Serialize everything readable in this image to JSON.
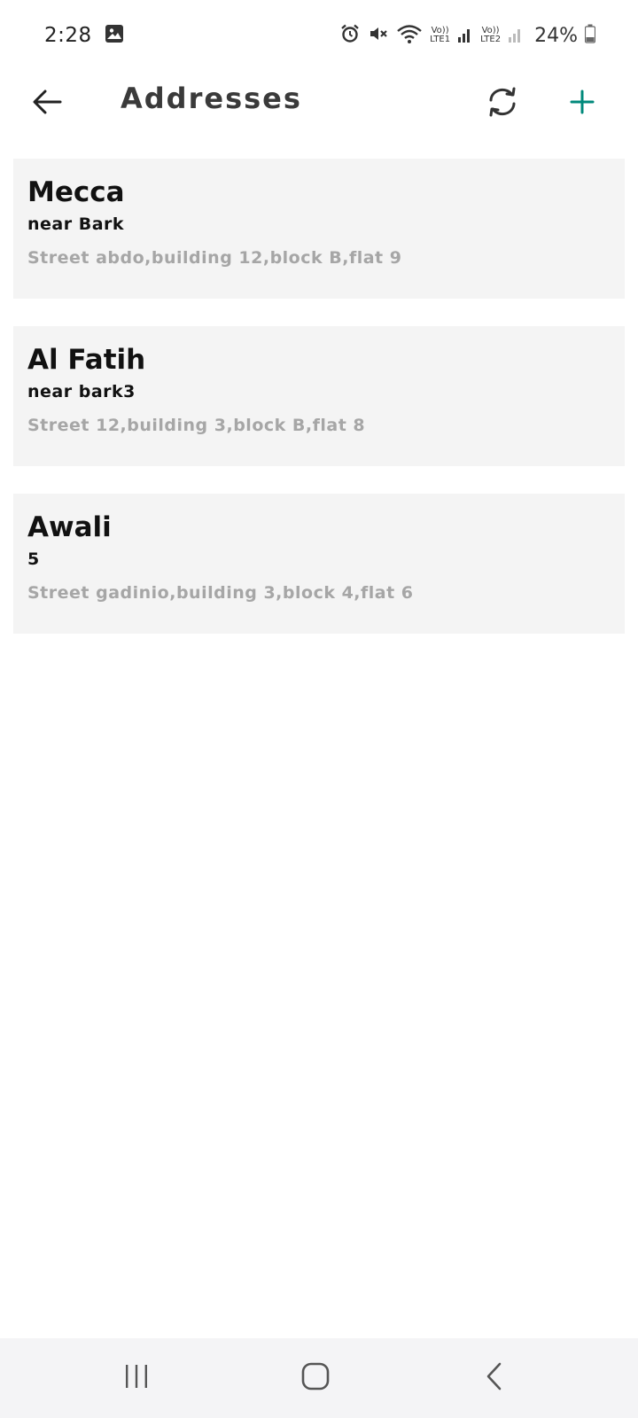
{
  "status_bar": {
    "time": "2:28",
    "net1_top": "Vo))",
    "net1_bottom": "LTE1",
    "net2_top": "Vo))",
    "net2_bottom": "LTE2",
    "battery": "24%"
  },
  "header": {
    "title": "Addresses",
    "accent_color": "#00897b"
  },
  "addresses": [
    {
      "name": "Mecca",
      "landmark": "near Bark",
      "details": "Street abdo,building 12,block B,flat 9"
    },
    {
      "name": "Al Fatih",
      "landmark": "near bark3",
      "details": "Street 12,building 3,block B,flat 8"
    },
    {
      "name": "Awali",
      "landmark": "5",
      "details": "Street gadinio,building 3,block 4,flat 6"
    }
  ],
  "icons": {
    "back": "arrow-left-icon",
    "refresh": "refresh-icon",
    "add": "plus-icon",
    "nav_recents": "recents-icon",
    "nav_home": "home-icon",
    "nav_back": "chevron-left-icon"
  }
}
